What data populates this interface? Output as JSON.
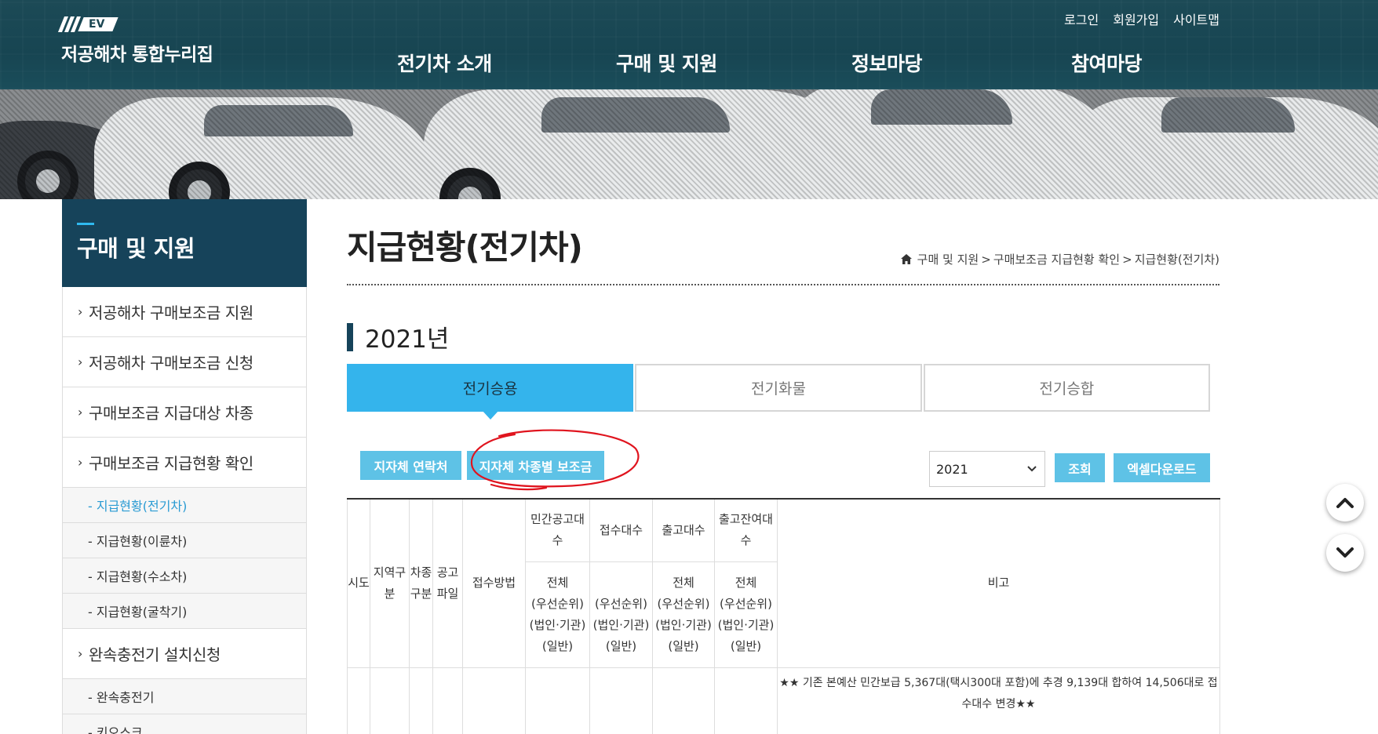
{
  "header": {
    "logo_badge": "EV",
    "site_name": "저공해차 통합누리집",
    "util_links": [
      "로그인",
      "회원가입",
      "사이트맵"
    ],
    "gnb": [
      "전기차 소개",
      "구매 및 지원",
      "정보마당",
      "참여마당"
    ]
  },
  "sidebar": {
    "title": "구매 및 지원",
    "items": [
      {
        "label": "저공해차 구매보조금 지원"
      },
      {
        "label": "저공해차 구매보조금 신청"
      },
      {
        "label": "구매보조금 지급대상 차종"
      },
      {
        "label": "구매보조금 지급현황 확인"
      }
    ],
    "subitems": [
      "- 지급현황(전기차)",
      "- 지급현황(이륜차)",
      "- 지급현황(수소차)",
      "- 지급현황(굴착기)"
    ],
    "item5": "완속충전기 설치신청",
    "subitems2": [
      "- 완속충전기",
      "- 키오스크"
    ]
  },
  "content": {
    "page_title": "지급현황(전기차)",
    "breadcrumb": [
      "구매 및 지원",
      "구매보조금 지급현황 확인",
      "지급현황(전기차)"
    ],
    "breadcrumb_sep": ">",
    "year_heading": "2021년",
    "tabs": [
      "전기승용",
      "전기화물",
      "전기승합"
    ],
    "active_tab": "전기승용",
    "buttons": {
      "contacts": "지자체 연락처",
      "subsidy_by_model": "지자체 차종별 보조금",
      "search": "조회",
      "excel": "엑셀다운로드"
    },
    "year_select": "2021"
  },
  "table": {
    "headers": {
      "sido": "시도",
      "region": "지역구분",
      "car_type": "차종구분",
      "notice_file": "공고파일",
      "method": "접수방법",
      "private_notice": "민간공고대수",
      "received": "접수대수",
      "released": "출고대수",
      "remaining": "출고잔여대수",
      "note": "비고"
    },
    "sub_header_lines": [
      "전체",
      "(우선순위)",
      "(법인·기관)",
      "(일반)"
    ],
    "first_row_note": "★★ 기존 본예산 민간보급 5,367대(택시300대 포함)에 추경 9,139대 합하여 14,506대로 접수대수 변경★★"
  },
  "colors": {
    "header_bg": "#1b4652",
    "sidebar_title_bg": "#16435a",
    "accent": "#34b4ec",
    "button": "#5ec2e6",
    "annotation": "#e0141e"
  }
}
